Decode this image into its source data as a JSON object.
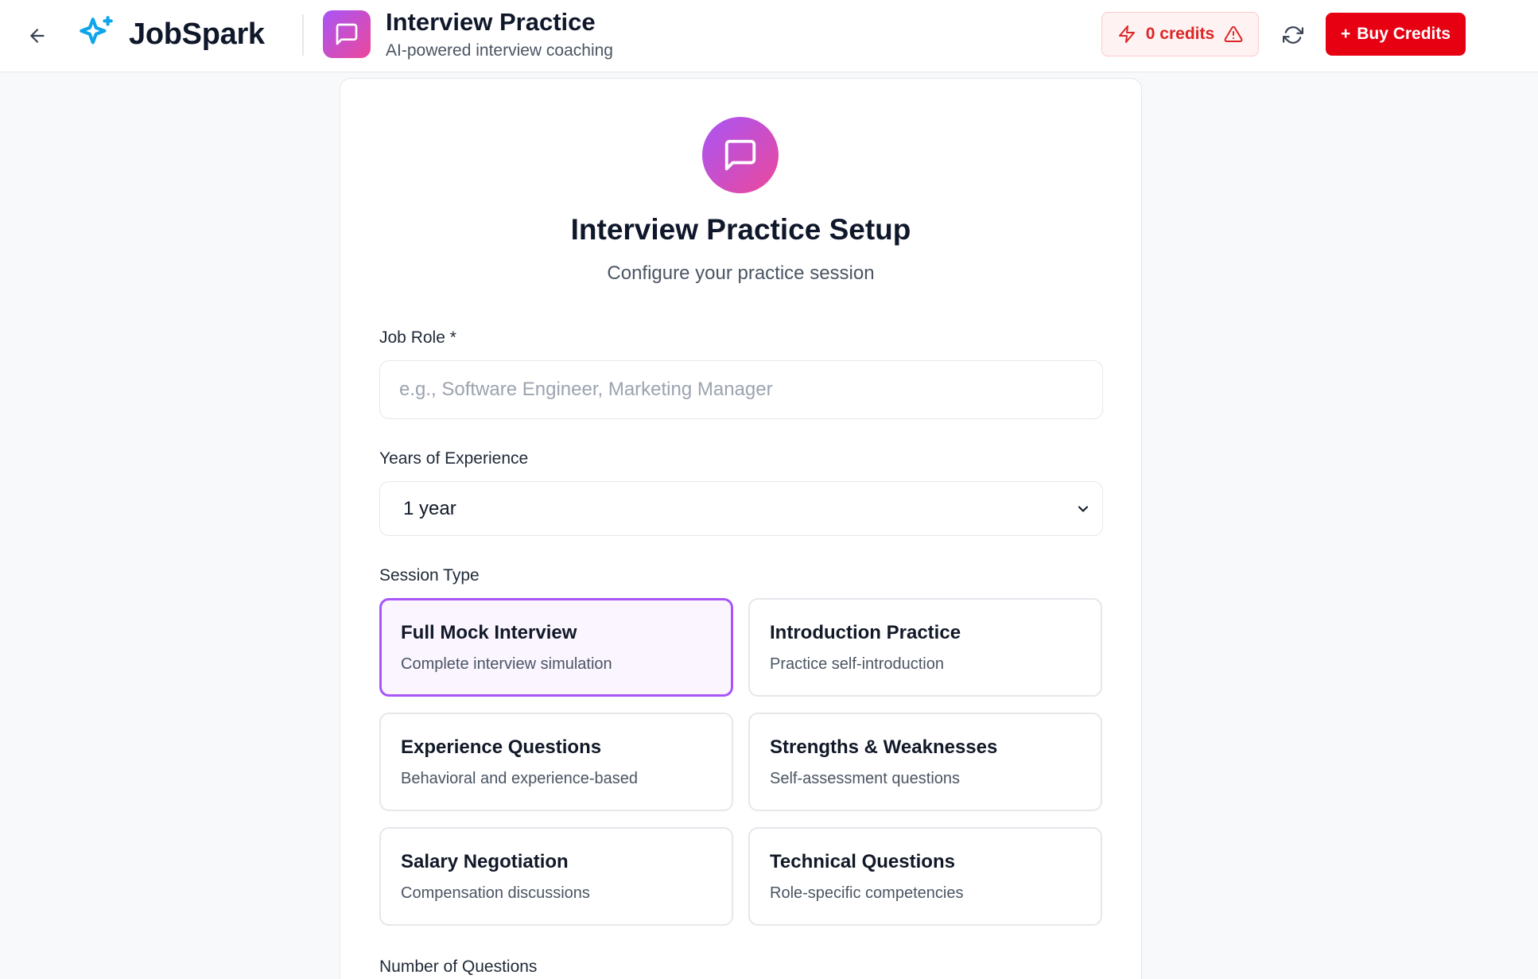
{
  "header": {
    "brand_name": "JobSpark",
    "page_title": "Interview Practice",
    "page_subtitle": "AI-powered interview coaching",
    "credits_label": "0 credits",
    "buy_label": "Buy Credits",
    "buy_prefix": "+"
  },
  "setup": {
    "title": "Interview Practice Setup",
    "subtitle": "Configure your practice session"
  },
  "form": {
    "job_role_label": "Job Role *",
    "job_role_value": "",
    "job_role_placeholder": "e.g., Software Engineer, Marketing Manager",
    "experience_label": "Years of Experience",
    "experience_value": "1 year",
    "session_type_label": "Session Type",
    "num_questions_label": "Number of Questions"
  },
  "session_types": [
    {
      "title": "Full Mock Interview",
      "desc": "Complete interview simulation",
      "selected": true
    },
    {
      "title": "Introduction Practice",
      "desc": "Practice self-introduction",
      "selected": false
    },
    {
      "title": "Experience Questions",
      "desc": "Behavioral and experience-based",
      "selected": false
    },
    {
      "title": "Strengths & Weaknesses",
      "desc": "Self-assessment questions",
      "selected": false
    },
    {
      "title": "Salary Negotiation",
      "desc": "Compensation discussions",
      "selected": false
    },
    {
      "title": "Technical Questions",
      "desc": "Role-specific competencies",
      "selected": false
    }
  ],
  "icons": {
    "back": "arrow-left-icon",
    "brand": "sparkles-icon",
    "page": "message-square-icon",
    "credits": "zap-icon",
    "warning": "alert-triangle-icon",
    "refresh": "refresh-icon",
    "select": "chevron-down-icon"
  },
  "colors": {
    "accent_gradient_start": "#a855f7",
    "accent_gradient_end": "#ec4899",
    "brand_blue": "#0ea5e9",
    "buy_red": "#e60012",
    "credits_red": "#dc2626",
    "selected_border": "#a855f7"
  }
}
